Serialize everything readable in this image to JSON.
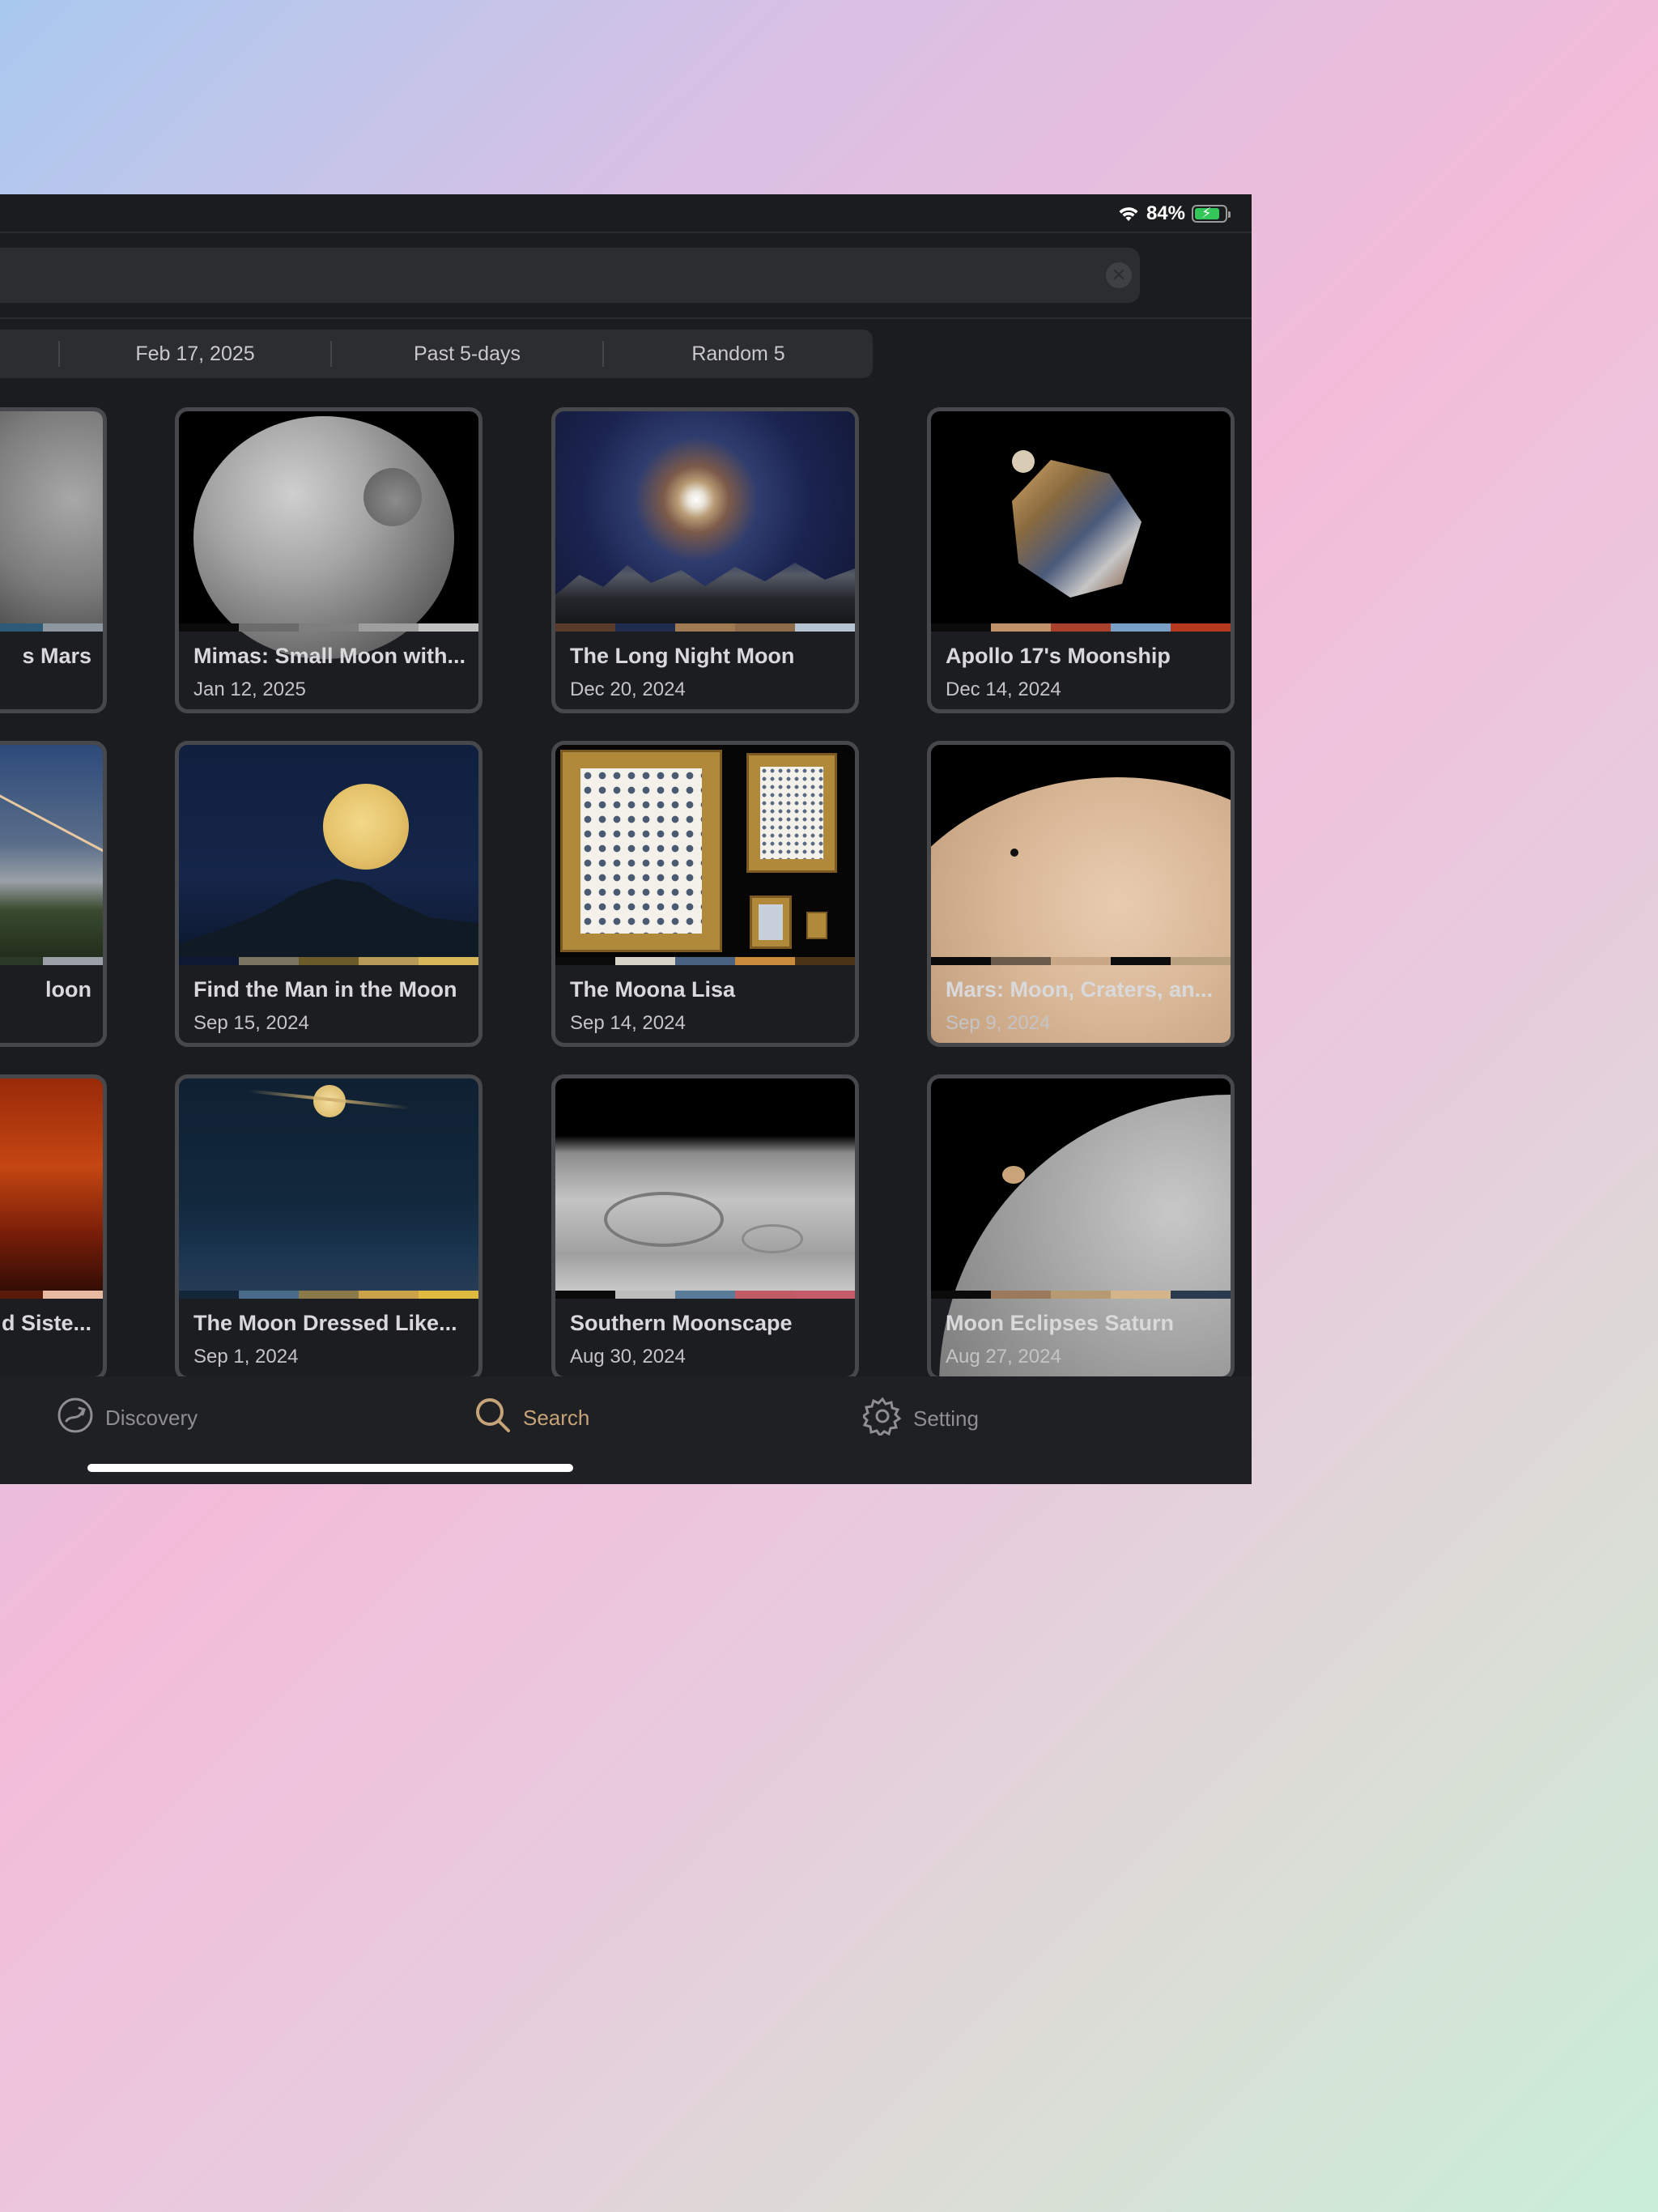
{
  "status": {
    "battery_percent": "84%",
    "battery_level": 0.84
  },
  "search": {
    "clear_icon": "clear-x-icon"
  },
  "filters": [
    {
      "label": ""
    },
    {
      "label": "Feb 17, 2025"
    },
    {
      "label": "Past 5-days"
    },
    {
      "label": "Random 5"
    }
  ],
  "cards": [
    {
      "title": "s Mars",
      "date": "",
      "palette": [
        "#1d1e1f",
        "#5a5f66",
        "#e3a676",
        "#2d5a78",
        "#8e96a0"
      ]
    },
    {
      "title": "Mimas: Small Moon with...",
      "date": "Jan 12, 2025",
      "palette": [
        "#0b0b0b",
        "#6b6b6b",
        "#7e7e7e",
        "#9e9e9e",
        "#c1c1c1"
      ]
    },
    {
      "title": "The Long Night Moon",
      "date": "Dec 20, 2024",
      "palette": [
        "#5a3a2a",
        "#1f2b4f",
        "#a07a52",
        "#8c6a4a",
        "#b6c3d3"
      ]
    },
    {
      "title": "Apollo 17's Moonship",
      "date": "Dec 14, 2024",
      "palette": [
        "#0b0b0b",
        "#c19268",
        "#a9412c",
        "#7aa0c8",
        "#b5381f"
      ]
    },
    {
      "title": "loon",
      "date": "",
      "palette": [
        "#3e4a5a",
        "#7a8090",
        "#d1a578",
        "#2b3a28",
        "#9aa0a6"
      ]
    },
    {
      "title": "Find the Man in the Moon",
      "date": "Sep 15, 2024",
      "palette": [
        "#0e1a33",
        "#7a7563",
        "#6b5a2a",
        "#b59a58",
        "#d8b75a"
      ]
    },
    {
      "title": "The Moona Lisa",
      "date": "Sep 14, 2024",
      "palette": [
        "#0b0b0b",
        "#d6d2c8",
        "#4a6282",
        "#c98a3c",
        "#4a3418"
      ]
    },
    {
      "title": "Mars: Moon, Craters, an...",
      "date": "Sep 9, 2024",
      "palette": [
        "#0b0b0b",
        "#6a5a4a",
        "#c9a888",
        "#0d0d0d",
        "#b9a07e"
      ]
    },
    {
      "title": "d Siste...",
      "date": "",
      "palette": [
        "#2a0e08",
        "#8a2a10",
        "#c98a6a",
        "#5a1a0a",
        "#e9b9a0"
      ]
    },
    {
      "title": "The Moon Dressed Like...",
      "date": "Sep 1, 2024",
      "palette": [
        "#14263a",
        "#4a6a8a",
        "#8a7a4a",
        "#c9a24a",
        "#e0b940"
      ]
    },
    {
      "title": "Southern Moonscape",
      "date": "Aug 30, 2024",
      "palette": [
        "#0b0b0b",
        "#bdbdbd",
        "#5a7a9a",
        "#c05a64",
        "#c65a6a"
      ]
    },
    {
      "title": "Moon Eclipses Saturn",
      "date": "Aug 27, 2024",
      "palette": [
        "#0b0b0b",
        "#9a7a5a",
        "#b59a72",
        "#d4b48a",
        "#2c3a4e"
      ]
    }
  ],
  "tabs": [
    {
      "label": "Discovery",
      "icon": "discovery-globe-icon"
    },
    {
      "label": "Search",
      "icon": "search-icon"
    },
    {
      "label": "Setting",
      "icon": "gear-icon"
    }
  ]
}
